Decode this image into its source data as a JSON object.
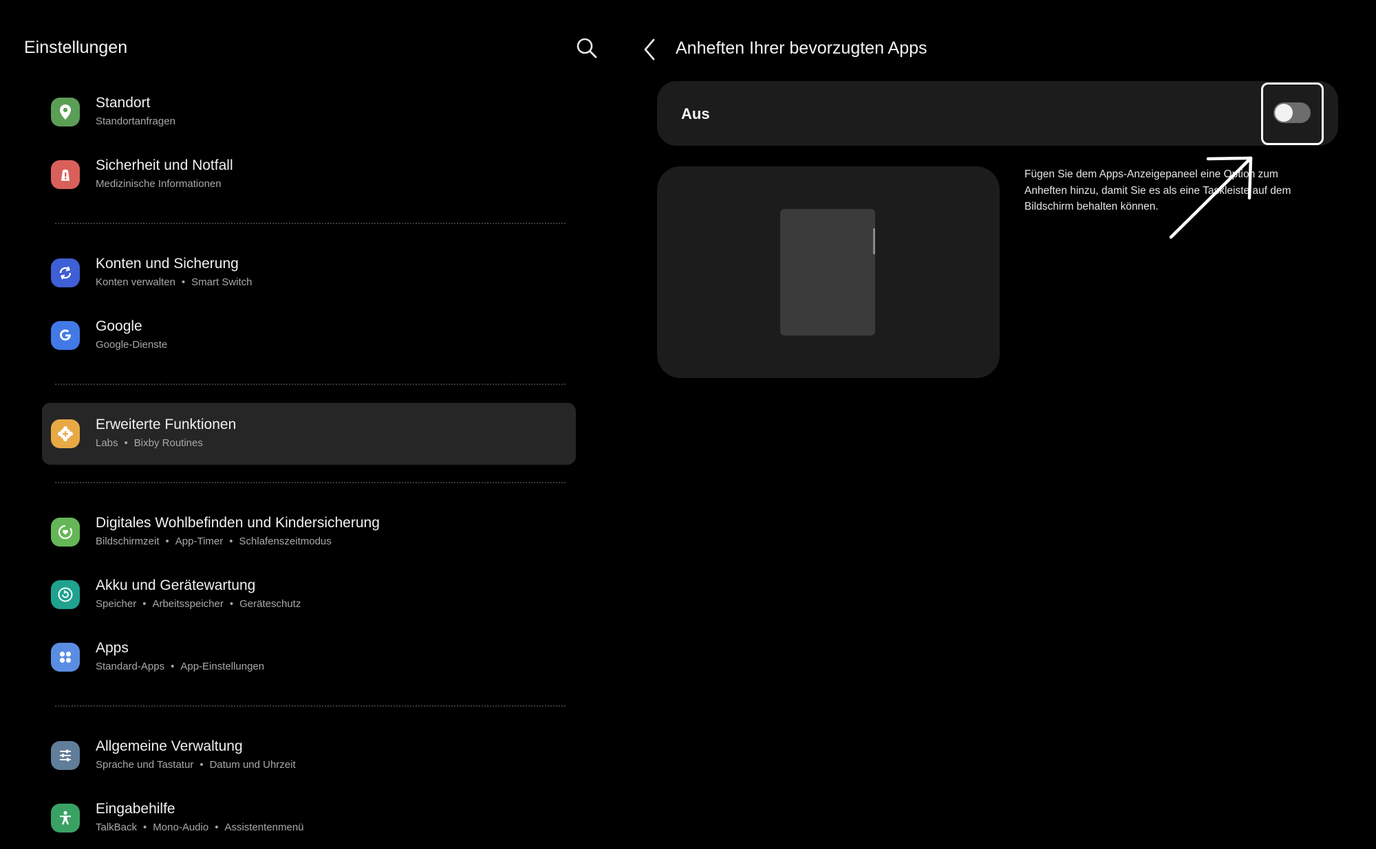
{
  "left_pane": {
    "title": "Einstellungen",
    "search_icon": "search-icon",
    "groups": [
      [
        {
          "title": "Standort",
          "subtitle": [
            "Standortanfragen"
          ],
          "icon": "location-icon",
          "color": "#5b9e55"
        },
        {
          "title": "Sicherheit und Notfall",
          "subtitle": [
            "Medizinische Informationen"
          ],
          "icon": "alert-icon",
          "color": "#d9605a"
        }
      ],
      [
        {
          "title": "Konten und Sicherung",
          "subtitle": [
            "Konten verwalten",
            "Smart Switch"
          ],
          "icon": "sync-icon",
          "color": "#3f5fd6"
        },
        {
          "title": "Google",
          "subtitle": [
            "Google-Dienste"
          ],
          "icon": "google-icon",
          "color": "#4279e6"
        }
      ],
      [
        {
          "title": "Erweiterte Funktionen",
          "subtitle": [
            "Labs",
            "Bixby Routines"
          ],
          "icon": "plus-gear-icon",
          "color": "#e8a945",
          "selected": true
        }
      ],
      [
        {
          "title": "Digitales Wohlbefinden und Kindersicherung",
          "subtitle": [
            "Bildschirmzeit",
            "App-Timer",
            "Schlafenszeitmodus"
          ],
          "icon": "heart-circle-icon",
          "color": "#64b657"
        },
        {
          "title": "Akku und Gerätewartung",
          "subtitle": [
            "Speicher",
            "Arbeitsspeicher",
            "Geräteschutz"
          ],
          "icon": "refresh-circle-icon",
          "color": "#1fa28f"
        },
        {
          "title": "Apps",
          "subtitle": [
            "Standard-Apps",
            "App-Einstellungen"
          ],
          "icon": "apps-icon",
          "color": "#5a8de2"
        }
      ],
      [
        {
          "title": "Allgemeine Verwaltung",
          "subtitle": [
            "Sprache und Tastatur",
            "Datum und Uhrzeit"
          ],
          "icon": "sliders-icon",
          "color": "#607d99"
        },
        {
          "title": "Eingabehilfe",
          "subtitle": [
            "TalkBack",
            "Mono-Audio",
            "Assistentenmenü"
          ],
          "icon": "accessibility-icon",
          "color": "#3aa164"
        }
      ]
    ]
  },
  "right_pane": {
    "back_icon": "back-arrow-icon",
    "title": "Anheften Ihrer bevorzugten Apps",
    "switch": {
      "label": "Aus",
      "state": "off"
    },
    "description": "Fügen Sie dem Apps-Anzeigepaneel eine Option zum Anheften hinzu, damit Sie es als eine Taskleiste auf dem Bildschirm behalten können."
  },
  "annotation": {
    "type": "arrow",
    "color": "#ffffff",
    "target": "toggle"
  }
}
